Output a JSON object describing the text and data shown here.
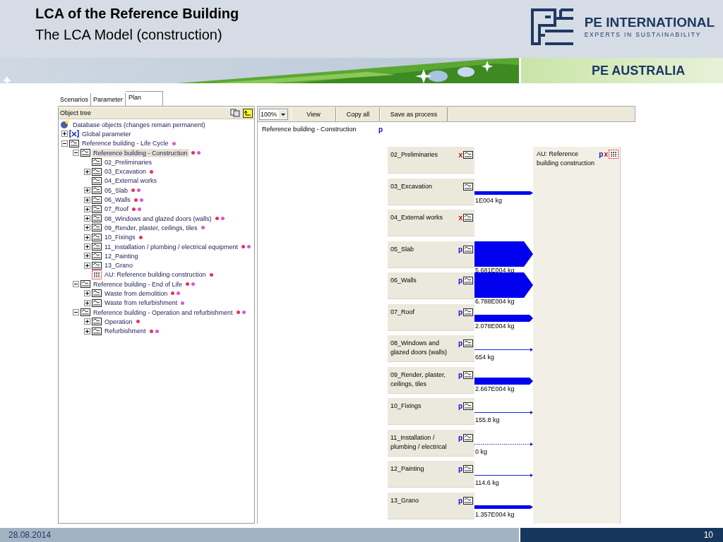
{
  "slide": {
    "title": "LCA of the Reference Building",
    "subtitle": "The LCA Model (construction)",
    "brand": "PE INTERNATIONAL",
    "tagline": "EXPERTS IN SUSTAINABILITY",
    "region": "PE AUSTRALIA"
  },
  "tabs": [
    {
      "label": "Scenarios",
      "selected": false
    },
    {
      "label": "Parameter",
      "selected": false
    },
    {
      "label": "Plan",
      "selected": true
    }
  ],
  "object_tree": {
    "header": "Object tree",
    "root": {
      "label": "Database objects (changes remain permanent)",
      "kind": "database",
      "selected": false,
      "children": [
        {
          "label": "Global parameter",
          "kind": "parameter",
          "expanded": false,
          "selected": false
        },
        {
          "label": "Reference building - Life Cycle",
          "kind": "plan",
          "expanded": true,
          "selected": false,
          "markers": [
            {
              "color": "#d45ad8"
            }
          ],
          "children": [
            {
              "label": "Reference building - Construction",
              "kind": "plan",
              "expanded": true,
              "selected": true,
              "markers": [
                {
                  "color": "#e8325a"
                },
                {
                  "color": "#d45ad8"
                }
              ],
              "children": [
                {
                  "label": "02_Preliminaries",
                  "kind": "plan",
                  "selected": false
                },
                {
                  "label": "03_Excavation",
                  "kind": "plan",
                  "expanded": false,
                  "selected": false,
                  "markers": [
                    {
                      "color": "#e8325a"
                    }
                  ]
                },
                {
                  "label": "04_External works",
                  "kind": "plan",
                  "selected": false
                },
                {
                  "label": "05_Slab",
                  "kind": "plan",
                  "expanded": false,
                  "selected": false,
                  "markers": [
                    {
                      "color": "#e8325a"
                    },
                    {
                      "color": "#d45ad8"
                    }
                  ]
                },
                {
                  "label": "06_Walls",
                  "kind": "plan",
                  "expanded": false,
                  "selected": false,
                  "markers": [
                    {
                      "color": "#e8325a"
                    },
                    {
                      "color": "#d45ad8"
                    }
                  ]
                },
                {
                  "label": "07_Roof",
                  "kind": "plan",
                  "expanded": false,
                  "selected": false,
                  "markers": [
                    {
                      "color": "#e8325a"
                    },
                    {
                      "color": "#d45ad8"
                    }
                  ]
                },
                {
                  "label": "08_Windows and glazed doors (walls)",
                  "kind": "plan",
                  "expanded": false,
                  "selected": false,
                  "markers": [
                    {
                      "color": "#e8325a"
                    },
                    {
                      "color": "#d45ad8"
                    }
                  ]
                },
                {
                  "label": "09_Render, plaster, ceilings, tiles",
                  "kind": "plan",
                  "expanded": false,
                  "selected": false,
                  "markers": [
                    {
                      "color": "#d45ad8"
                    }
                  ]
                },
                {
                  "label": "10_Fixings",
                  "kind": "plan",
                  "expanded": false,
                  "selected": false,
                  "markers": [
                    {
                      "color": "#e8325a"
                    }
                  ]
                },
                {
                  "label": "11_Installation / plumbing / electrical equipment",
                  "kind": "plan",
                  "expanded": false,
                  "selected": false,
                  "markers": [
                    {
                      "color": "#e8325a"
                    },
                    {
                      "color": "#d45ad8"
                    }
                  ]
                },
                {
                  "label": "12_Painting",
                  "kind": "plan",
                  "expanded": false,
                  "selected": false
                },
                {
                  "label": "13_Grano",
                  "kind": "plan",
                  "expanded": false,
                  "selected": false
                },
                {
                  "label": "AU: Reference building construction",
                  "kind": "unit",
                  "selected": false,
                  "markers": [
                    {
                      "color": "#e8325a"
                    }
                  ]
                }
              ]
            },
            {
              "label": "Reference building - End of Life",
              "kind": "plan",
              "expanded": true,
              "selected": false,
              "markers": [
                {
                  "color": "#e8325a"
                },
                {
                  "color": "#d45ad8"
                }
              ],
              "children": [
                {
                  "label": "Waste from demolition",
                  "kind": "plan",
                  "expanded": false,
                  "selected": false,
                  "markers": [
                    {
                      "color": "#e8325a"
                    },
                    {
                      "color": "#d45ad8"
                    }
                  ]
                },
                {
                  "label": "Waste from refurbishment",
                  "kind": "plan",
                  "expanded": false,
                  "selected": false,
                  "markers": [
                    {
                      "color": "#d45ad8"
                    }
                  ]
                }
              ]
            },
            {
              "label": "Reference building - Operation and refurbishment",
              "kind": "plan",
              "expanded": true,
              "selected": false,
              "markers": [
                {
                  "color": "#e8325a"
                },
                {
                  "color": "#d45ad8"
                }
              ],
              "children": [
                {
                  "label": "Operation",
                  "kind": "plan",
                  "expanded": false,
                  "selected": false,
                  "markers": [
                    {
                      "color": "#e8325a"
                    }
                  ]
                },
                {
                  "label": "Refurbishment",
                  "kind": "plan",
                  "expanded": false,
                  "selected": false,
                  "markers": [
                    {
                      "color": "#e8325a"
                    },
                    {
                      "color": "#d45ad8"
                    }
                  ]
                }
              ]
            }
          ]
        }
      ]
    }
  },
  "toolbar": {
    "zoom": "100%",
    "buttons": [
      "View",
      "Copy all",
      "Save as process"
    ]
  },
  "plan": {
    "title": "Reference building - Construction",
    "flag": {
      "text": "p",
      "kind": "param"
    },
    "processes": [
      {
        "label": "02_Preliminaries",
        "flag": {
          "text": "x",
          "kind": "cross"
        }
      },
      {
        "label": "03_Excavation",
        "flow": {
          "kind": "medium"
        },
        "amount": "1E004 kg"
      },
      {
        "label": "04_External works",
        "flag": {
          "text": "x",
          "kind": "cross"
        }
      },
      {
        "label": "05_Slab",
        "flag": {
          "text": "p",
          "kind": "param"
        },
        "flow": {
          "kind": "wide"
        },
        "amount": "5.681E004 kg"
      },
      {
        "label": "06_Walls",
        "flag": {
          "text": "p",
          "kind": "param"
        },
        "flow": {
          "kind": "wide"
        },
        "amount": "6.788E004 kg"
      },
      {
        "label": "07_Roof",
        "flag": {
          "text": "p",
          "kind": "param"
        },
        "flow": {
          "kind": "thick"
        },
        "amount": "2.078E004 kg"
      },
      {
        "label": "08_Windows and glazed doors (walls)",
        "flag": {
          "text": "p",
          "kind": "param"
        },
        "flow": {
          "kind": "thin"
        },
        "amount": "654 kg"
      },
      {
        "label": "09_Render, plaster, ceilings, tiles",
        "flag": {
          "text": "p",
          "kind": "param"
        },
        "flow": {
          "kind": "thick"
        },
        "amount": "2.667E004 kg"
      },
      {
        "label": "10_Fixings",
        "flag": {
          "text": "p",
          "kind": "param"
        },
        "flow": {
          "kind": "thin"
        },
        "amount": "155.8 kg"
      },
      {
        "label": "11_Installation / plumbing / electrical",
        "flag": {
          "text": "p",
          "kind": "param"
        },
        "flow": {
          "kind": "dotted"
        },
        "amount": "0 kg"
      },
      {
        "label": "12_Painting",
        "flag": {
          "text": "p",
          "kind": "param"
        },
        "flow": {
          "kind": "thin"
        },
        "amount": "114.6 kg"
      },
      {
        "label": "13_Grano",
        "flag": {
          "text": "p",
          "kind": "param"
        },
        "flow": {
          "kind": "medium"
        },
        "amount": "1.357E004 kg"
      }
    ],
    "target": {
      "label": "AU: Reference building construction",
      "flags": [
        {
          "text": "p",
          "kind": "param"
        },
        {
          "text": "x",
          "kind": "cross"
        }
      ]
    }
  },
  "footer": {
    "date": "28.08.2014",
    "page": "10"
  }
}
